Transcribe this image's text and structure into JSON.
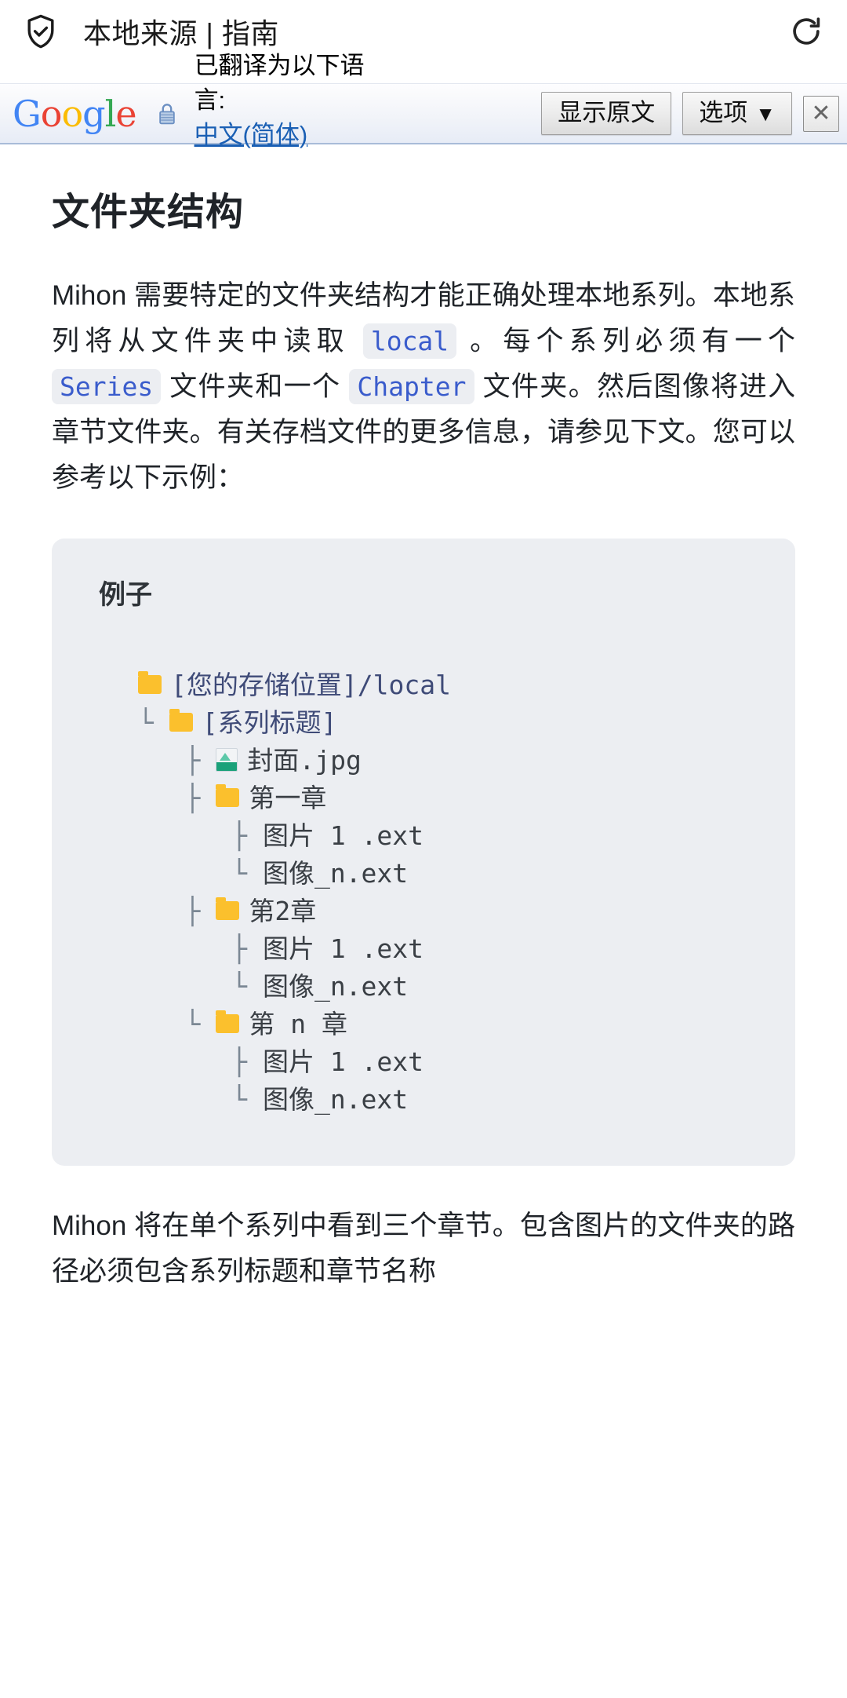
{
  "browser": {
    "shield_icon": "shield-check-icon",
    "page_title": "本地来源 | 指南",
    "reload_icon": "reload-icon"
  },
  "translate_bar": {
    "brand_letters": [
      "G",
      "o",
      "o",
      "g",
      "l",
      "e"
    ],
    "lock_icon": "lock-icon",
    "message": "已翻译为以下语言:",
    "language_link": "中文(简体)",
    "show_original_label": "显示原文",
    "options_label": "选项",
    "options_caret": "▼",
    "close_label": "✕",
    "close_icon": "close-icon"
  },
  "article": {
    "heading": "文件夹结构",
    "paragraph1": {
      "seg1": "Mihon 需要特定的文件夹结构才能正确处理本地系列。本地系列将从文件夹中读取 ",
      "code1": "local",
      "seg2": " 。每个系列必须有一个 ",
      "code2": "Series",
      "seg3": " 文件夹和一个 ",
      "code3": "Chapter",
      "seg4": " 文件夹。然后图像将进入章节文件夹。有关存档文件的更多信息，请参见下文。您可以参考以下示例："
    },
    "paragraph2": "Mihon 将在单个系列中看到三个章节。包含图片的文件夹的路径必须包含系列标题和章节名称"
  },
  "codeblock": {
    "title": "例子",
    "tree": [
      {
        "guide": "",
        "icon": "folder",
        "label": "[您的存储位置]/local",
        "style": "blue"
      },
      {
        "guide": "└ ",
        "icon": "folder",
        "label": "[系列标题]",
        "style": "blue"
      },
      {
        "guide": "   ├ ",
        "icon": "image",
        "label": "封面.jpg",
        "style": "dim"
      },
      {
        "guide": "   ├ ",
        "icon": "folder",
        "label": "第一章",
        "style": "dim"
      },
      {
        "guide": "      ├ ",
        "icon": "none",
        "label": "图片 1 .ext",
        "style": "dim"
      },
      {
        "guide": "      └ ",
        "icon": "none",
        "label": "图像_n.ext",
        "style": "dim"
      },
      {
        "guide": "   ├ ",
        "icon": "folder",
        "label": "第2章",
        "style": "dim"
      },
      {
        "guide": "      ├ ",
        "icon": "none",
        "label": "图片 1 .ext",
        "style": "dim"
      },
      {
        "guide": "      └ ",
        "icon": "none",
        "label": "图像_n.ext",
        "style": "dim"
      },
      {
        "guide": "   └ ",
        "icon": "folder",
        "label": "第 n 章",
        "style": "dim"
      },
      {
        "guide": "      ├ ",
        "icon": "none",
        "label": "图片 1 .ext",
        "style": "dim"
      },
      {
        "guide": "      └ ",
        "icon": "none",
        "label": "图像_n.ext",
        "style": "dim"
      }
    ]
  },
  "colors": {
    "code_bg": "#eceef2",
    "inline_code_text": "#3a5ccc",
    "folder_yellow": "#FBC02D",
    "tree_guide": "#7b8794",
    "link_blue": "#1a5fb4",
    "google_blue": "#4285F4",
    "google_red": "#EA4335",
    "google_yellow": "#FBBC05",
    "google_green": "#34A853"
  }
}
